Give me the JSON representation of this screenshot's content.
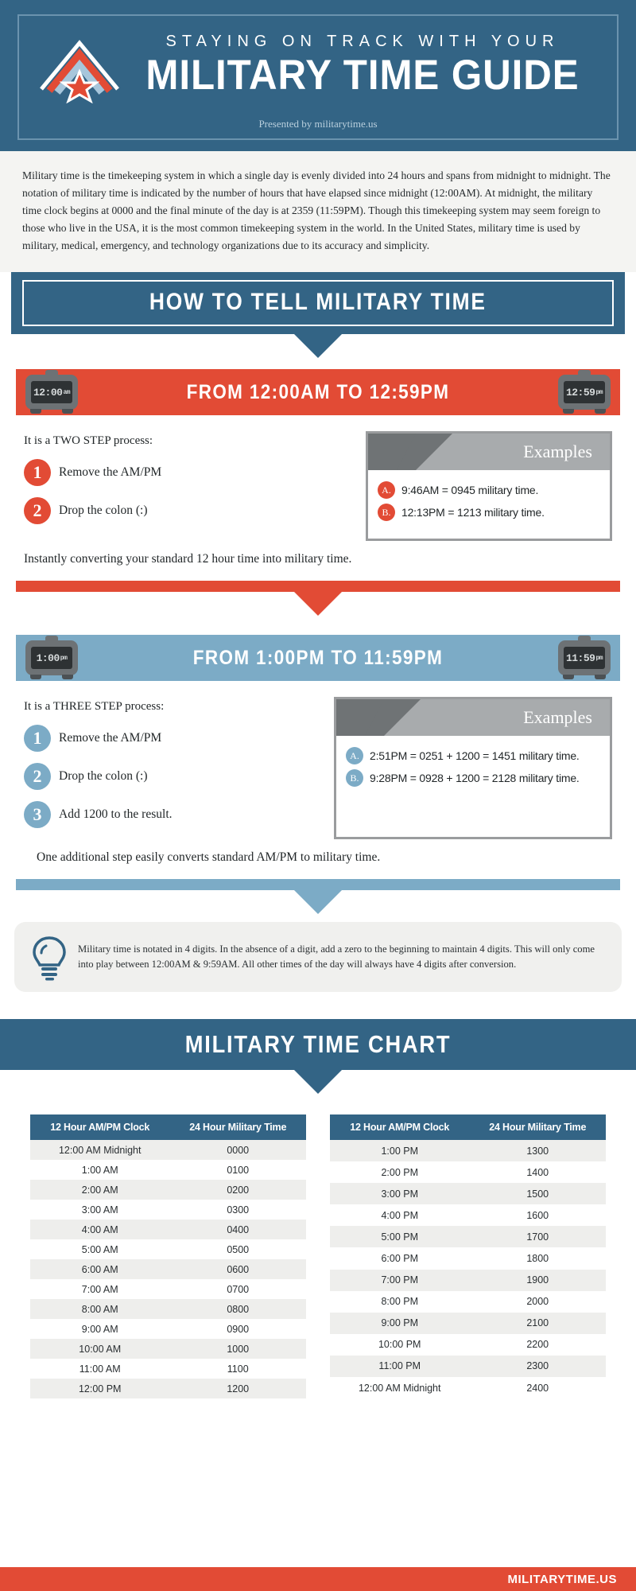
{
  "header": {
    "kicker": "STAYING ON TRACK WITH YOUR",
    "title": "MILITARY TIME GUIDE",
    "presented_by": "Presented by militarytime.us",
    "logo_name": "chevron-star-military-logo",
    "bg_color": "#336485"
  },
  "intro": {
    "paragraph": "Military time is the timekeeping system in which a single day is evenly divided into 24 hours and spans from midnight to midnight. The notation of military time is indicated by the number of hours that have elapsed since midnight (12:00AM). At midnight, the military time clock begins at 0000 and the final minute of the day is at 2359 (11:59PM). Though this timekeeping system may seem foreign to those who live in the USA, it is the most common timekeeping system in the world. In the United States, military time is used by military, medical, emergency, and technology organizations due to its accuracy and simplicity."
  },
  "section_how": {
    "banner": "HOW TO TELL MILITARY TIME"
  },
  "am_section": {
    "range_title": "FROM 12:00AM TO 12:59PM",
    "clock_left": {
      "time": "12:00",
      "ampm": "am"
    },
    "clock_right": {
      "time": "12:59",
      "ampm": "pm"
    },
    "lead": "It is a TWO STEP process:",
    "steps": [
      {
        "num": "1",
        "label": "Remove the AM/PM"
      },
      {
        "num": "2",
        "label": "Drop the colon (:)"
      }
    ],
    "examples_title": "Examples",
    "examples": [
      {
        "bullet": "A.",
        "text": "9:46AM = 0945 military time."
      },
      {
        "bullet": "B.",
        "text": "12:13PM = 1213 military time."
      }
    ],
    "closing": "Instantly converting your standard 12 hour time into military time.",
    "accent_color": "#e24b35"
  },
  "pm_section": {
    "range_title": "FROM 1:00PM TO 11:59PM",
    "clock_left": {
      "time": "1:00",
      "ampm": "pm"
    },
    "clock_right": {
      "time": "11:59",
      "ampm": "pm"
    },
    "lead": "It is a THREE STEP process:",
    "steps": [
      {
        "num": "1",
        "label": "Remove the AM/PM"
      },
      {
        "num": "2",
        "label": "Drop the colon (:)"
      },
      {
        "num": "3",
        "label": "Add 1200 to the result."
      }
    ],
    "examples_title": "Examples",
    "examples": [
      {
        "bullet": "A.",
        "text": "2:51PM = 0251 + 1200 = 1451 military time."
      },
      {
        "bullet": "B.",
        "text": "9:28PM = 0928 + 1200 = 2128 military time."
      }
    ],
    "closing": "One additional step easily converts standard AM/PM to military time.",
    "accent_color": "#7cabc6"
  },
  "tip": {
    "icon_name": "lightbulb-icon",
    "text": "Military time is notated in 4 digits. In the absence of a digit, add a zero to the beginning to maintain 4 digits. This will only come into play between 12:00AM & 9:59AM. All other times of the day will always have 4 digits after conversion."
  },
  "chart": {
    "banner": "MILITARY TIME CHART",
    "headers": [
      "12 Hour AM/PM Clock",
      "24 Hour Military Time"
    ],
    "left_rows": [
      [
        "12:00 AM Midnight",
        "0000"
      ],
      [
        "1:00 AM",
        "0100"
      ],
      [
        "2:00 AM",
        "0200"
      ],
      [
        "3:00 AM",
        "0300"
      ],
      [
        "4:00 AM",
        "0400"
      ],
      [
        "5:00 AM",
        "0500"
      ],
      [
        "6:00 AM",
        "0600"
      ],
      [
        "7:00 AM",
        "0700"
      ],
      [
        "8:00 AM",
        "0800"
      ],
      [
        "9:00 AM",
        "0900"
      ],
      [
        "10:00 AM",
        "1000"
      ],
      [
        "11:00 AM",
        "1100"
      ],
      [
        "12:00 PM",
        "1200"
      ]
    ],
    "right_rows": [
      [
        "1:00 PM",
        "1300"
      ],
      [
        "2:00 PM",
        "1400"
      ],
      [
        "3:00 PM",
        "1500"
      ],
      [
        "4:00 PM",
        "1600"
      ],
      [
        "5:00 PM",
        "1700"
      ],
      [
        "6:00 PM",
        "1800"
      ],
      [
        "7:00 PM",
        "1900"
      ],
      [
        "8:00 PM",
        "2000"
      ],
      [
        "9:00 PM",
        "2100"
      ],
      [
        "10:00 PM",
        "2200"
      ],
      [
        "11:00 PM",
        "2300"
      ],
      [
        "12:00 AM Midnight",
        "2400"
      ]
    ]
  },
  "footer": {
    "text": "MILITARYTIME.US",
    "bg_color": "#e24b35"
  }
}
